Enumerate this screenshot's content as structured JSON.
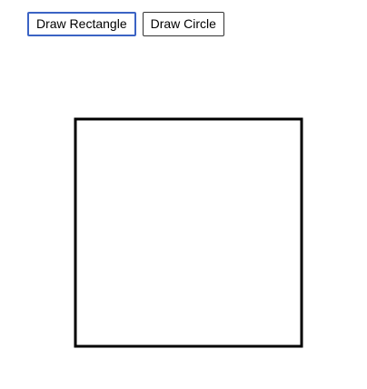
{
  "toolbar": {
    "draw_rectangle_label": "Draw Rectangle",
    "draw_circle_label": "Draw Circle"
  },
  "canvas": {
    "shape": "rectangle",
    "stroke_color": "#000000",
    "fill_color": "#ffffff"
  },
  "colors": {
    "focus_ring": "#3b63c4"
  }
}
